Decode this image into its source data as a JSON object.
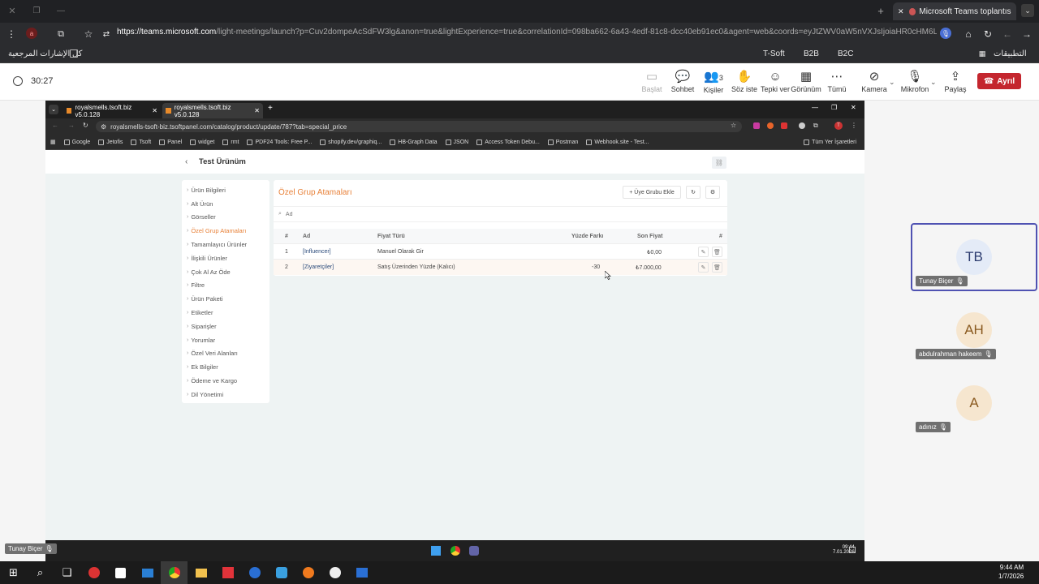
{
  "outer_browser": {
    "tab_title": "Microsoft Teams toplantısı",
    "url_host": "https://teams.microsoft.com",
    "url_rest": "/light-meetings/launch?p=Cuv2dompeAcSdFW3lg&anon=true&lightExperience=true&correlationId=098ba662-6a43-4edf-81c8-dcc40eb91ec0&agent=web&coords=eyJtZWV0aW5nVXJsIjoiaHR0cHM6Ly90ZWFtcy5",
    "bookmarks_right": "كل الإشارات المرجعية",
    "bookmarks_left": [
      "T-Soft",
      "B2B",
      "B2C"
    ],
    "apps_label": "التطبيقات"
  },
  "teams": {
    "timer": "30:27",
    "toolbar": [
      {
        "glyph": "▭",
        "label": "Başlat"
      },
      {
        "glyph": "💬",
        "label": "Sohbet"
      },
      {
        "glyph": "👥",
        "label": "Kişiler"
      },
      {
        "glyph": "✋",
        "label": "Söz iste"
      },
      {
        "glyph": "☺",
        "label": "Tepki ver"
      },
      {
        "glyph": "▦",
        "label": "Görünüm"
      },
      {
        "glyph": "⋯",
        "label": "Tümü"
      }
    ],
    "people_count": "3",
    "camera_label": "Kamera",
    "mic_label": "Mikrofon",
    "share_label": "Paylaş",
    "leave_label": "Ayrıl",
    "participants": [
      {
        "initials": "TB",
        "name": "Tunay Biçer",
        "bg": "#e4ebf7",
        "fg": "#2b3b6e"
      },
      {
        "initials": "AH",
        "name": "abdulrahman hakeem",
        "bg": "#f6e6cf",
        "fg": "#8a5a20"
      },
      {
        "initials": "A",
        "name": "adınız",
        "bg": "#f6e6cf",
        "fg": "#8a5a20"
      }
    ],
    "presenter_name": "Tunay Biçer"
  },
  "inner_browser": {
    "tabs": [
      "royalsmells.tsoft.biz v5.0.128",
      "royalsmells.tsoft.biz v5.0.128"
    ],
    "url": "royalsmells-tsoft-biz.tsoftpanel.com/catalog/product/update/787?tab=special_price",
    "bookmarks": [
      "Google",
      "Jetofis",
      "Tsoft",
      "Panel",
      "widget",
      "rmt",
      "PDF24 Tools: Free P...",
      "shopify.dev/graphiq...",
      "HB-Graph Data",
      "JSON",
      "Access Token Debu...",
      "Postman",
      "Webhook.site - Test..."
    ],
    "bookmarks_all": "Tüm Yer İşaretleri"
  },
  "panel_page": {
    "title": "Test Ürünüm",
    "sidebar": [
      "Ürün Bilgileri",
      "Alt Ürün",
      "Görseller",
      "Özel Grup Atamaları",
      "Tamamlayıcı Ürünler",
      "İlişkili Ürünler",
      "Çok Al Az Öde",
      "Filtre",
      "Ürün Paketi",
      "Etiketler",
      "Siparişler",
      "Yorumlar",
      "Özel Veri Alanları",
      "Ek Bilgiler",
      "Ödeme ve Kargo",
      "Dil Yönetimi"
    ],
    "section_title": "Özel Grup Atamaları",
    "add_button": "+ Üye Grubu Ekle",
    "search_placeholder": "Ad",
    "columns": {
      "num": "#",
      "name": "Ad",
      "type": "Fiyat Türü",
      "pct": "Yüzde Farkı",
      "final": "Son Fiyat",
      "actions": "#"
    },
    "rows": [
      {
        "num": "1",
        "name": "[Influencer]",
        "type": "Manuel Olarak Gir",
        "pct": "",
        "final": "₺0,00"
      },
      {
        "num": "2",
        "name": "[Ziyaretçiler]",
        "type": "Satış Üzerinden Yüzde (Kalıcı)",
        "pct": "-30",
        "final": "₺7.000,00"
      }
    ]
  },
  "inner_taskbar": {
    "time": "09:44",
    "date": "7.01.2026"
  },
  "taskbar": {
    "time": "9:44 AM",
    "date": "1/7/2026"
  }
}
